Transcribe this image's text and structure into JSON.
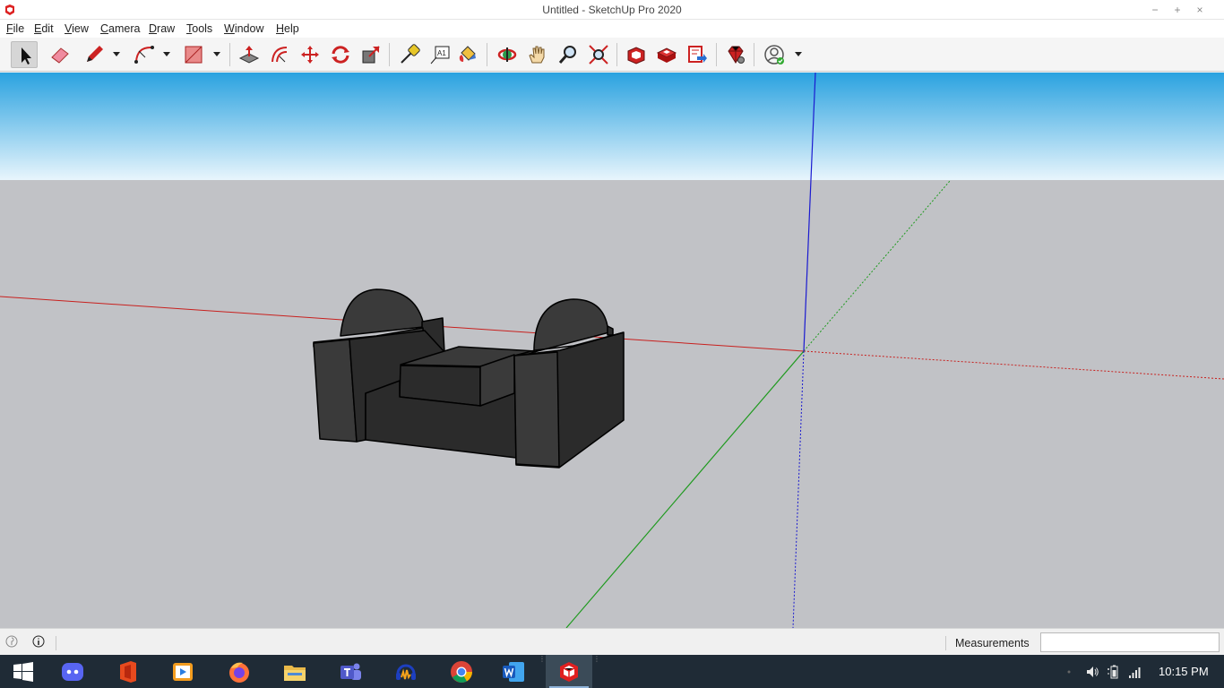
{
  "window": {
    "title": "Untitled - SketchUp Pro 2020",
    "minimize": "−",
    "maximize": "+",
    "close": "×"
  },
  "menu": [
    {
      "label": "File",
      "key": "F",
      "rest": "ile"
    },
    {
      "label": "Edit",
      "key": "E",
      "rest": "dit"
    },
    {
      "label": "View",
      "key": "V",
      "rest": "iew"
    },
    {
      "label": "Camera",
      "key": "C",
      "rest": "amera"
    },
    {
      "label": "Draw",
      "key": "D",
      "rest": "raw"
    },
    {
      "label": "Tools",
      "key": "T",
      "rest": "ools"
    },
    {
      "label": "Window",
      "key": "W",
      "rest": "indow"
    },
    {
      "label": "Help",
      "key": "H",
      "rest": "elp"
    }
  ],
  "toolbar": {
    "tools": [
      "select-tool",
      "eraser-tool",
      "line-tool",
      "arc-tool",
      "rectangle-tool",
      "push-pull-tool",
      "offset-tool",
      "move-tool",
      "rotate-tool",
      "scale-tool",
      "tape-measure-tool",
      "text-tool",
      "paint-bucket-tool",
      "orbit-tool",
      "pan-tool",
      "zoom-tool",
      "zoom-extents-tool",
      "3d-warehouse-icon",
      "extension-warehouse-icon",
      "send-to-layout-icon",
      "extension-manager-icon",
      "account-icon"
    ],
    "selected": "select-tool",
    "text_tool_glyph": "A1"
  },
  "colors": {
    "sky_top": "#2aa2e0",
    "sky_bottom": "#e8f5fc",
    "ground": "#c1c2c6",
    "model_face": "#3a3a3a",
    "model_side": "#2b2b2b",
    "axis_red": "#c8201e",
    "axis_green": "#1f9a1f",
    "axis_blue": "#1a1ad0"
  },
  "status": {
    "measurements_label": "Measurements",
    "measurements_value": ""
  },
  "taskbar": {
    "apps": [
      "windows-start-icon",
      "discord-icon",
      "office-icon",
      "media-player-icon",
      "firefox-icon",
      "file-explorer-icon",
      "teams-icon",
      "audacity-icon",
      "chrome-icon",
      "word-icon",
      "sketchup-icon"
    ],
    "active": "sketchup-icon",
    "clock": "10:15 PM"
  }
}
